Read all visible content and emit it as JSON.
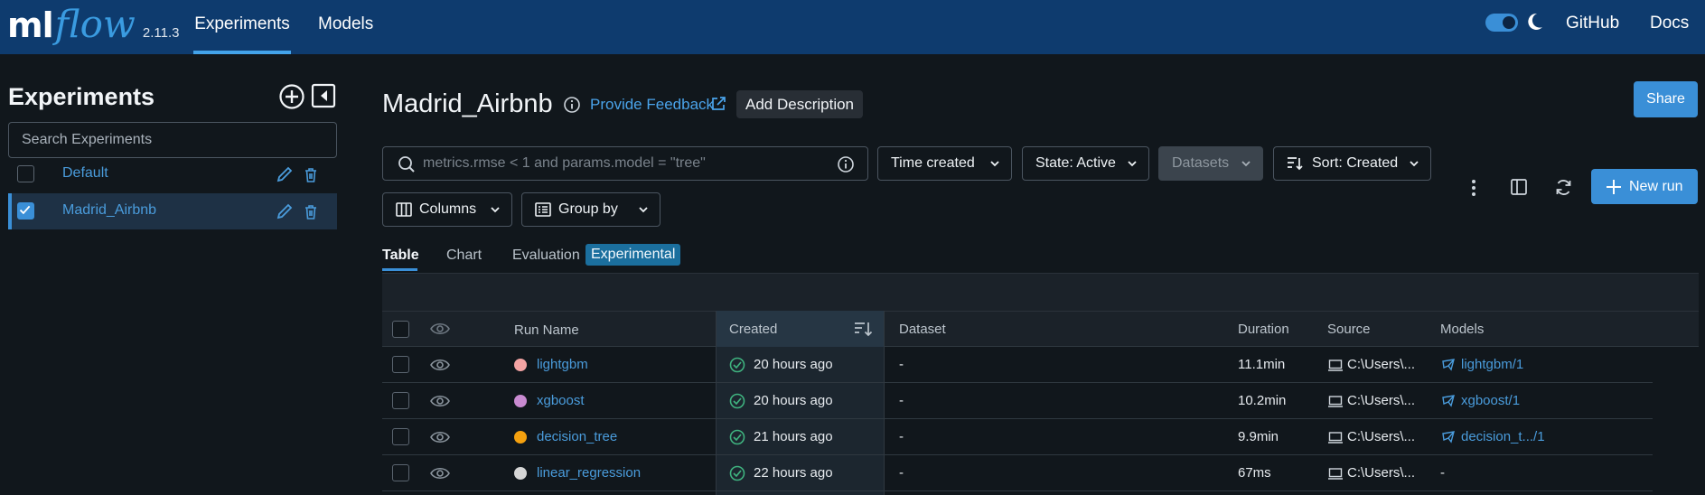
{
  "nav": {
    "logo_ml": "ml",
    "logo_flow": "flow",
    "version": "2.11.3",
    "tabs": [
      {
        "label": "Experiments"
      },
      {
        "label": "Models"
      }
    ],
    "github": "GitHub",
    "docs": "Docs"
  },
  "sidebar": {
    "title": "Experiments",
    "search_placeholder": "Search Experiments",
    "experiments": [
      {
        "name": "Default",
        "checked": false
      },
      {
        "name": "Madrid_Airbnb",
        "checked": true
      }
    ]
  },
  "header": {
    "title": "Madrid_Airbnb",
    "feedback": "Provide Feedback",
    "add_description": "Add Description",
    "share": "Share"
  },
  "filters": {
    "search_placeholder": "metrics.rmse < 1 and params.model = \"tree\"",
    "time_created": "Time created",
    "state": "State: Active",
    "datasets": "Datasets",
    "sort": "Sort: Created",
    "columns": "Columns",
    "group_by": "Group by",
    "new_run": "New run"
  },
  "view_tabs": {
    "table": "Table",
    "chart": "Chart",
    "evaluation": "Evaluation",
    "experimental": "Experimental"
  },
  "table": {
    "headers": {
      "run_name": "Run Name",
      "created": "Created",
      "dataset": "Dataset",
      "duration": "Duration",
      "source": "Source",
      "models": "Models"
    },
    "rows": [
      {
        "run_name": "lightgbm",
        "color": "#f4a4a4",
        "created": "20 hours ago",
        "dataset": "-",
        "duration": "11.1min",
        "source": "C:\\Users\\...",
        "model": "lightgbm/1"
      },
      {
        "run_name": "xgboost",
        "color": "#c98bd1",
        "created": "20 hours ago",
        "dataset": "-",
        "duration": "10.2min",
        "source": "C:\\Users\\...",
        "model": "xgboost/1"
      },
      {
        "run_name": "decision_tree",
        "color": "#f5a10f",
        "created": "21 hours ago",
        "dataset": "-",
        "duration": "9.9min",
        "source": "C:\\Users\\...",
        "model": "decision_t.../1"
      },
      {
        "run_name": "linear_regression",
        "color": "#d6d6d6",
        "created": "22 hours ago",
        "dataset": "-",
        "duration": "67ms",
        "source": "C:\\Users\\...",
        "model": "-"
      }
    ]
  },
  "colors": {
    "nav_bg": "#0e3b6e",
    "accent": "#3a8fd7",
    "link": "#4a9cdc",
    "success": "#3fb27f"
  }
}
